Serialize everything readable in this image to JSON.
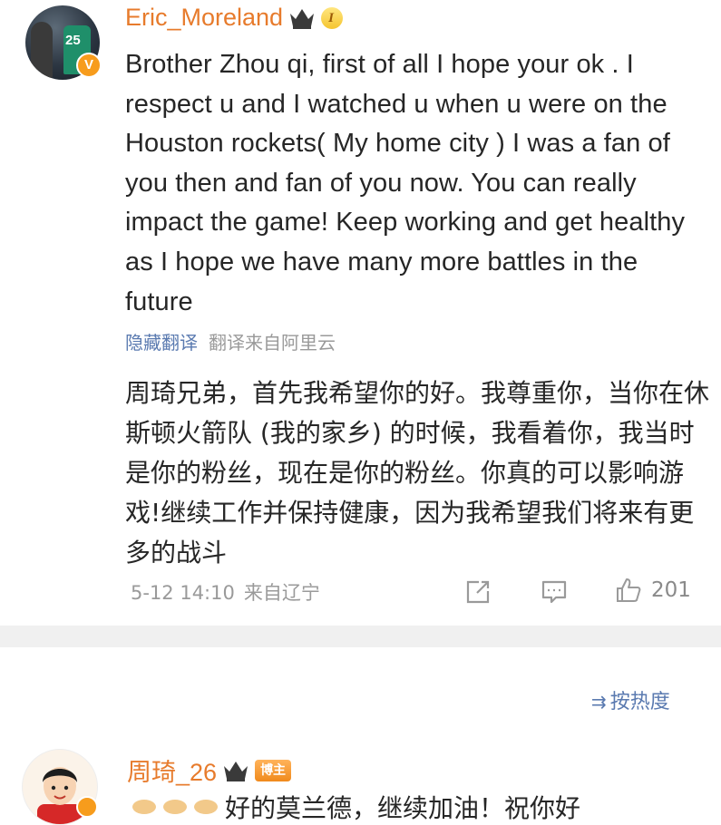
{
  "comment1": {
    "username": "Eric_Moreland",
    "avatar_number": "25",
    "verified_badge": "V",
    "level_badge": "I",
    "text_en": "Brother Zhou qi, first of all I hope your ok . I respect u and I watched u when u were on the Houston rockets( My home city ) I was a fan of you then and fan of you now. You can really impact the game! Keep working and get healthy as I hope we have many more battles in the future",
    "hide_translation": "隐藏翻译",
    "translation_source": "翻译来自阿里云",
    "text_zh": "周琦兄弟，首先我希望你的好。我尊重你，当你在休斯顿火箭队 (我的家乡) 的时候，我看着你，我当时是你的粉丝，现在是你的粉丝。你真的可以影响游戏!继续工作并保持健康，因为我希望我们将来有更多的战斗",
    "time": "5-12 14:10",
    "location": "来自辽宁",
    "like_count": "201",
    "icons": [
      "share-icon",
      "comment-icon",
      "like-icon"
    ]
  },
  "sort": {
    "icon": "⇉",
    "label": "按热度"
  },
  "comment2": {
    "username": "周琦_26",
    "host_tag": "博主",
    "text": "好的莫兰德，继续加油！祝你好"
  },
  "colors": {
    "username": "#e77b2c",
    "link": "#5a7ab0",
    "meta": "#9a9a9a",
    "divider": "#f0f0f0"
  }
}
